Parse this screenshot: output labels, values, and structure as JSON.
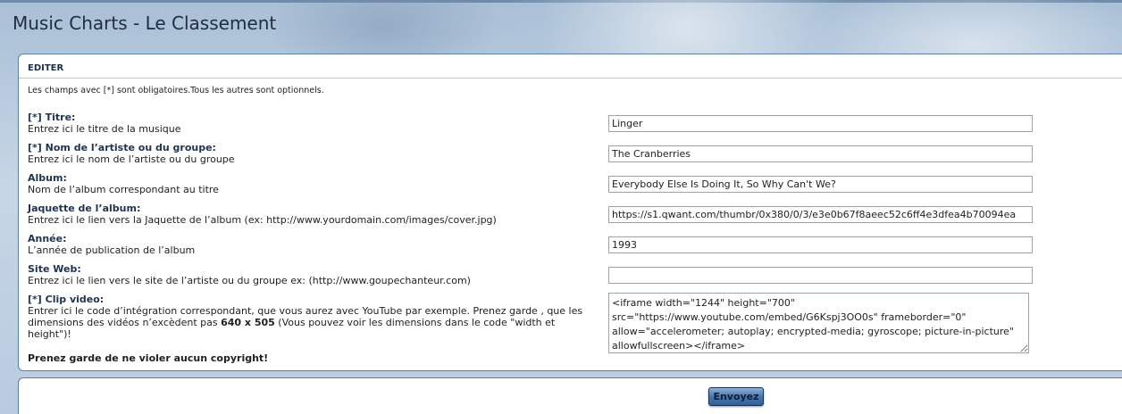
{
  "page": {
    "title": "Music Charts - Le Classement"
  },
  "form": {
    "header": "EDITER",
    "intro": "Les champs avec [*] sont obligatoires.Tous les autres sont optionnels.",
    "fields": [
      {
        "label": "[*] Titre:",
        "desc": "Entrez ici le titre de la musique",
        "value": "Linger"
      },
      {
        "label": "[*] Nom de l’artiste ou du groupe:",
        "desc": "Entrez ici le nom de l’artiste ou du groupe",
        "value": "The Cranberries"
      },
      {
        "label": "Album:",
        "desc": "Nom de l’album correspondant au titre",
        "value": "Everybody Else Is Doing It, So Why Can't We?"
      },
      {
        "label": "Jaquette de l’album:",
        "desc": "Entrez ici le lien vers la Jaquette de l’album (ex: http://www.yourdomain.com/images/cover.jpg)",
        "value": "https://s1.qwant.com/thumbr/0x380/0/3/e3e0b67f8aeec52c6ff4e3dfea4b70094ea"
      },
      {
        "label": "Année:",
        "desc": "L’année de publication de l’album",
        "value": "1993"
      },
      {
        "label": "Site Web:",
        "desc": "Entrez ici le lien vers le site de l’artiste ou du groupe ex: (http://www.goupechanteur.com)",
        "value": ""
      }
    ],
    "clip": {
      "label": "[*] Clip video:",
      "desc_part1": "Entrer ici le code d’intégration correspondant, que vous aurez avec YouTube par exemple. Prenez garde , que les dimensions des vidéos n’excèdent pas ",
      "desc_bold": "640 x 505",
      "desc_part2": " (Vous pouvez voir les dimensions dans le code \"width et height\")!",
      "value": "<iframe width=\"1244\" height=\"700\" src=\"https://www.youtube.com/embed/G6Kspj3OO0s\" frameborder=\"0\" allow=\"accelerometer; autoplay; encrypted-media; gyroscope; picture-in-picture\" allowfullscreen></iframe>"
    },
    "copyright_warning": "Prenez garde de ne violer aucun copyright!",
    "submit_label": "Envoyez"
  }
}
